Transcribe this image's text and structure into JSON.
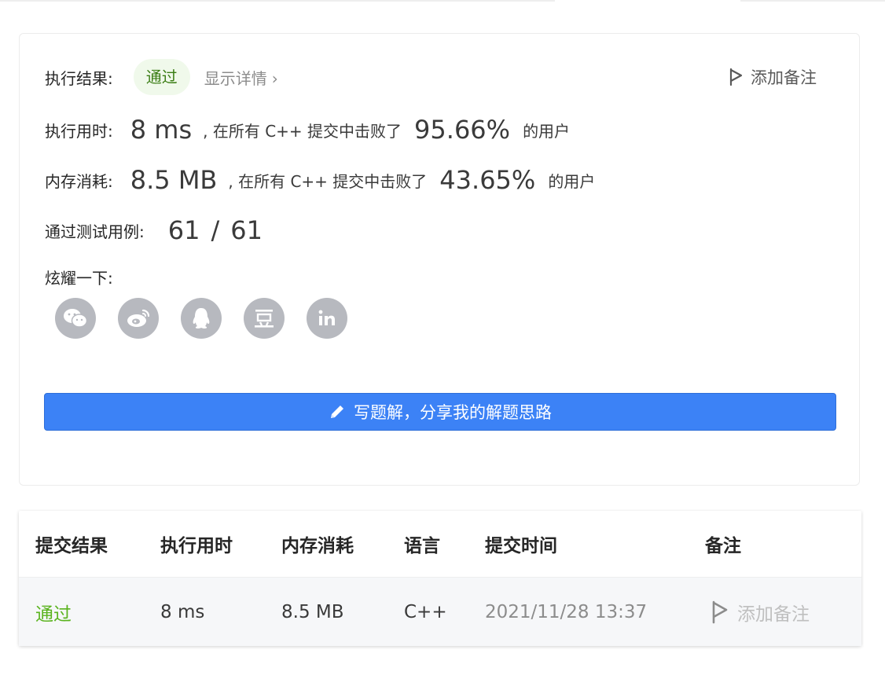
{
  "result": {
    "status_label": "执行结果:",
    "status_value": "通过",
    "detail_link": "显示详情",
    "detail_chevron": "›",
    "add_note": "添加备注",
    "runtime_label": "执行用时:",
    "runtime_value": "8 ms",
    "runtime_text": ", 在所有 C++ 提交中击败了",
    "runtime_percent": "95.66%",
    "runtime_suffix": "的用户",
    "memory_label": "内存消耗:",
    "memory_value": "8.5 MB",
    "memory_text": ", 在所有 C++ 提交中击败了",
    "memory_percent": "43.65%",
    "memory_suffix": "的用户",
    "tests_label": "通过测试用例:",
    "tests_passed": "61",
    "tests_sep": "/",
    "tests_total": "61",
    "share_label": "炫耀一下:",
    "share_icons": [
      "wechat-icon",
      "weibo-icon",
      "qq-icon",
      "douban-icon",
      "linkedin-icon"
    ],
    "write_solution": "写题解，分享我的解题思路"
  },
  "table": {
    "headers": [
      "提交结果",
      "执行用时",
      "内存消耗",
      "语言",
      "提交时间",
      "备注"
    ],
    "rows": [
      {
        "result": "通过",
        "runtime": "8 ms",
        "memory": "8.5 MB",
        "language": "C++",
        "time": "2021/11/28 13:37",
        "note": "添加备注"
      }
    ]
  },
  "colors": {
    "accent": "#3c82f6",
    "pass_green": "#5ab31e",
    "pass_bg": "#f0f9eb",
    "icon_gray": "#b7b9bf"
  }
}
